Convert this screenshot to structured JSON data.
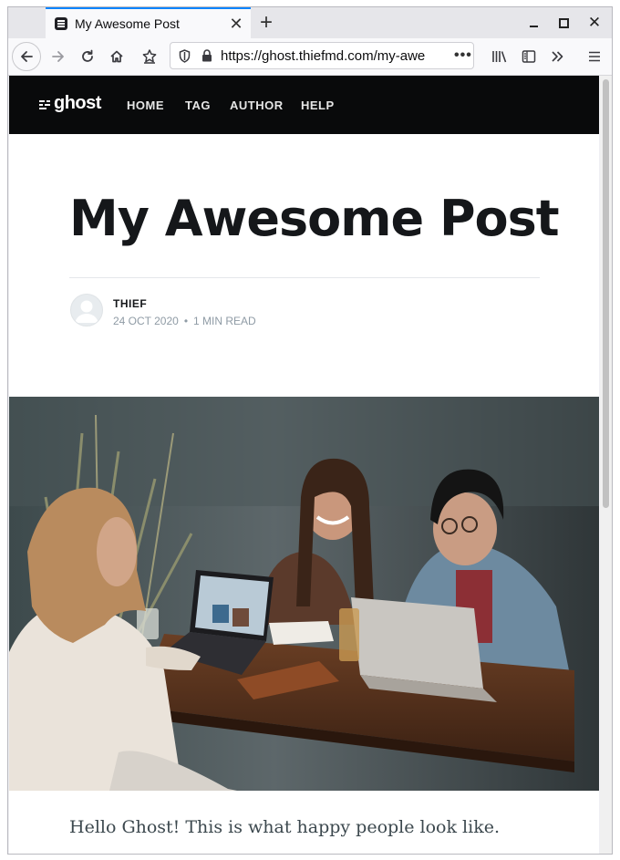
{
  "browser": {
    "tab": {
      "title": "My Awesome Post",
      "favicon": "ghost-favicon-icon"
    },
    "url": "https://ghost.thiefmd.com/my-awe",
    "url_more": "•••"
  },
  "site": {
    "logo": "ghost",
    "nav": [
      {
        "label": "HOME"
      },
      {
        "label": "TAG"
      },
      {
        "label": "AUTHOR"
      },
      {
        "label": "HELP"
      }
    ],
    "header_bg": "#090a0b"
  },
  "post": {
    "title": "My Awesome Post",
    "author": "THIEF",
    "date": "24 OCT 2020",
    "separator": "•",
    "reading_time": "1 MIN READ",
    "excerpt": "Hello Ghost! This is what happy people look like."
  },
  "colors": {
    "accent_tab": "#0a84ff",
    "title": "#15171a",
    "meta": "#8f9ba5"
  }
}
